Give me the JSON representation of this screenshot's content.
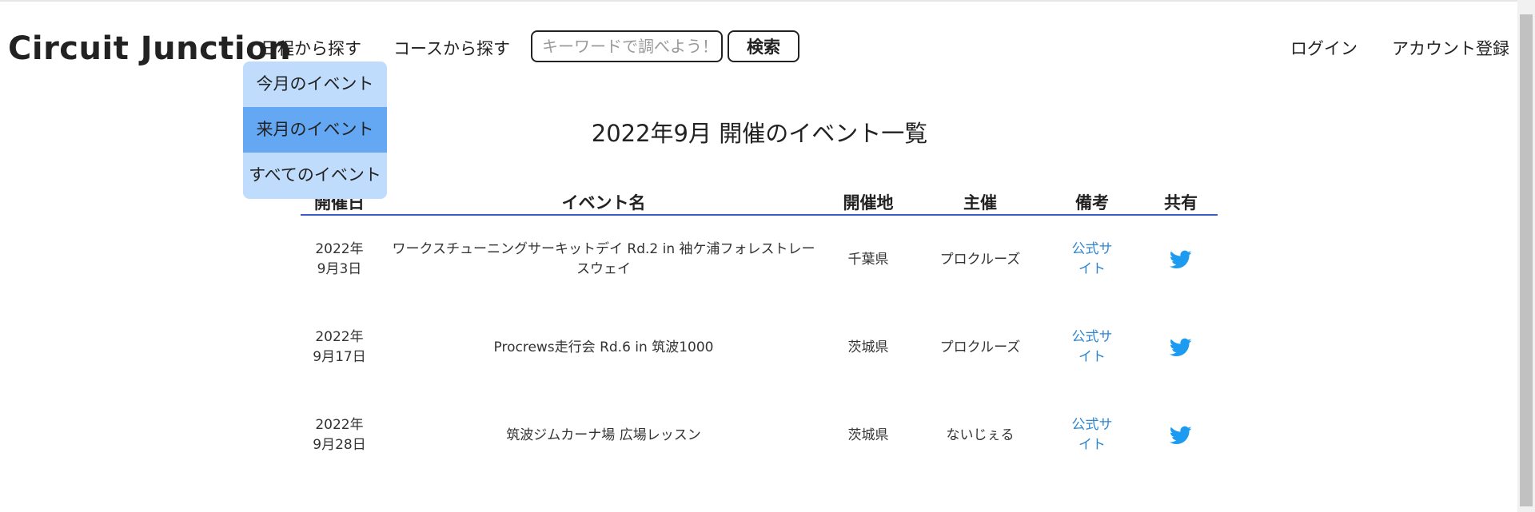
{
  "header": {
    "brand": "Circuit Junction",
    "nav": {
      "schedule": "日程から探す",
      "course": "コースから探す",
      "login": "ログイン",
      "register": "アカウント登録"
    },
    "search": {
      "placeholder": "キーワードで調べよう！",
      "value": "",
      "button": "検索"
    }
  },
  "dropdown": {
    "items": [
      {
        "label": "今月のイベント",
        "active": false
      },
      {
        "label": "来月のイベント",
        "active": true
      },
      {
        "label": "すべてのイベント",
        "active": false
      }
    ]
  },
  "page_title": "2022年9月 開催のイベント一覧",
  "table": {
    "headers": {
      "date": "開催日",
      "name": "イベント名",
      "place": "開催地",
      "organizer": "主催",
      "note": "備考",
      "share": "共有"
    },
    "rows": [
      {
        "date": "2022年\n9月3日",
        "name": "ワークスチューニングサーキットデイ Rd.2 in 袖ケ浦フォレストレースウェイ",
        "place": "千葉県",
        "organizer": "プロクルーズ",
        "note": "公式サイト",
        "share_icon": "twitter-icon"
      },
      {
        "date": "2022年\n9月17日",
        "name": "Procrews走行会 Rd.6 in 筑波1000",
        "place": "茨城県",
        "organizer": "プロクルーズ",
        "note": "公式サイト",
        "share_icon": "twitter-icon"
      },
      {
        "date": "2022年\n9月28日",
        "name": "筑波ジムカーナ場 広場レッスン",
        "place": "茨城県",
        "organizer": "ないじぇる",
        "note": "公式サイト",
        "share_icon": "twitter-icon"
      }
    ]
  },
  "colors": {
    "dropdown_bg": "#c0dcfc",
    "dropdown_active": "#64a8f4",
    "table_rule": "#3a5cc8",
    "link": "#2e86d1",
    "twitter": "#1d9bf0"
  }
}
